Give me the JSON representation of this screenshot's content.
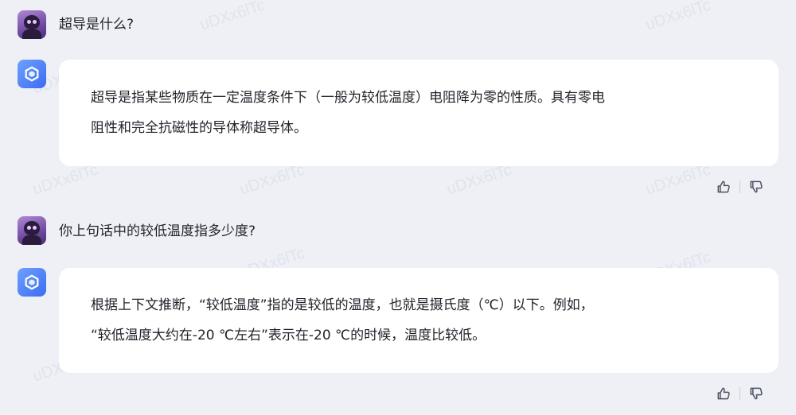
{
  "watermark": "uDXx6lTc",
  "conversation": [
    {
      "question": "超导是什么?",
      "answer_lines": [
        "超导是指某些物质在一定温度条件下（一般为较低温度）电阻降为零的性质。具有零电",
        "阻性和完全抗磁性的导体称超导体。"
      ]
    },
    {
      "question": "你上句话中的较低温度指多少度?",
      "answer_lines": [
        "根据上下文推断，“较低温度”指的是较低的温度，也就是摄氏度（℃）以下。例如，",
        "“较低温度大约在-20 ℃左右”表示在-20 ℃的时候，温度比较低。"
      ]
    }
  ],
  "icons": {
    "user_avatar": "user-avatar-robot",
    "bot_avatar": "bot-logo-icon",
    "like": "thumbs-up-icon",
    "dislike": "thumbs-down-icon"
  },
  "colors": {
    "background": "#eef0f6",
    "bubble": "#ffffff",
    "bot_accent": "#3b6cf0",
    "user_avatar": "#6f4aa0"
  }
}
